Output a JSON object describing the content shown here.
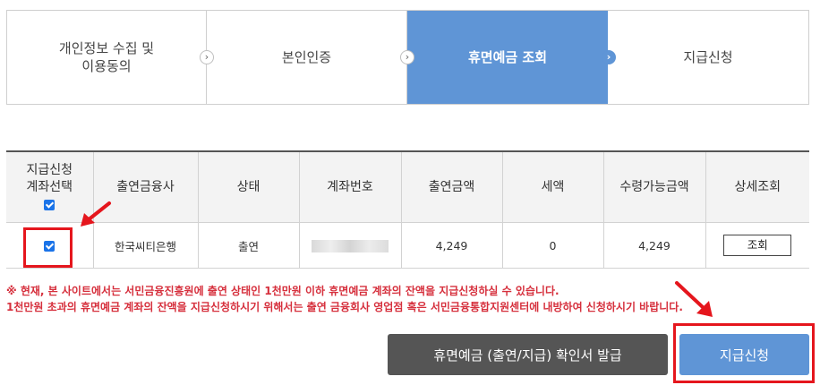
{
  "steps": [
    {
      "label": "개인정보 수집 및\n이용동의",
      "active": false
    },
    {
      "label": "본인인증",
      "active": false
    },
    {
      "label": "휴면예금 조회",
      "active": true
    },
    {
      "label": "지급신청",
      "active": false
    }
  ],
  "table": {
    "headers": {
      "select": "지급신청\n계좌선택",
      "bank": "출연금융사",
      "status": "상태",
      "account": "계좌번호",
      "amount": "출연금액",
      "tax": "세액",
      "receivable": "수령가능금액",
      "detail": "상세조회"
    },
    "header_checkbox_checked": true,
    "rows": [
      {
        "checked": true,
        "bank": "한국씨티은행",
        "status": "출연",
        "account_masked": true,
        "amount": "4,249",
        "tax": "0",
        "receivable": "4,249",
        "detail_button": "조회"
      }
    ]
  },
  "notices": [
    "※ 현재, 본 사이트에서는 서민금융진흥원에 출연 상태인 1천만원 이하 휴면예금 계좌의 잔액을 지급신청하실 수 있습니다.",
    "1천만원 초과의 휴면예금 계좌의 잔액을 지급신청하시기 위해서는 출연 금융회사 영업점 혹은 서민금융통합지원센터에 내방하여 신청하시기 바랍니다."
  ],
  "buttons": {
    "issue_certificate": "휴면예금 (출연/지급) 확인서 발급",
    "apply": "지급신청"
  },
  "colors": {
    "active_step": "#5f95d6",
    "highlight": "#e5161d",
    "notice_text": "#d6303d",
    "dark_button": "#555555",
    "checkbox": "#1a73e8"
  }
}
